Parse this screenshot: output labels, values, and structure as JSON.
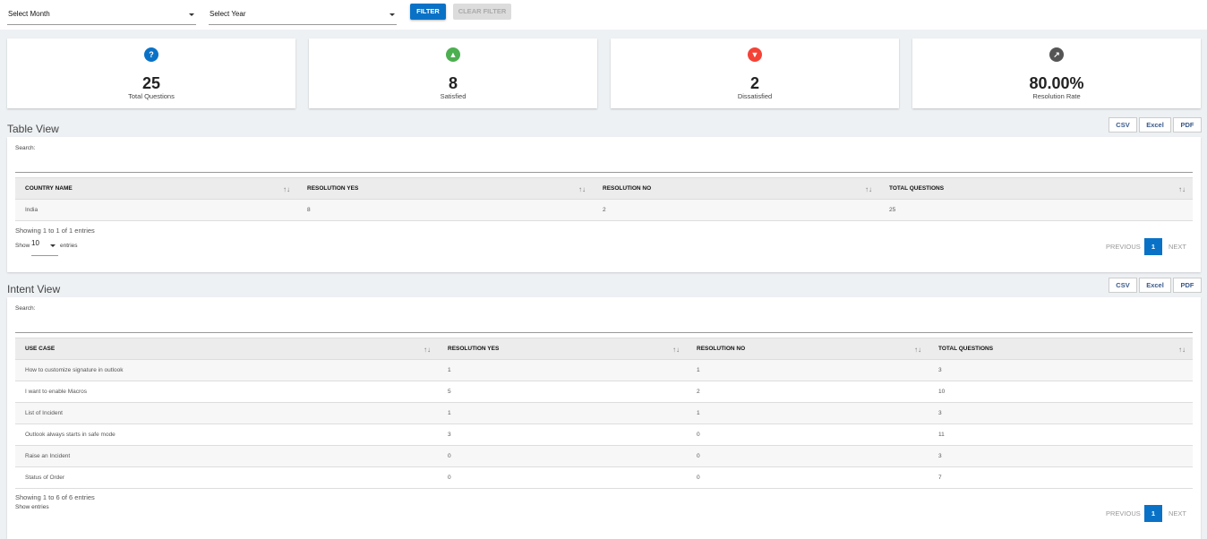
{
  "filters": {
    "month_placeholder": "Select Month",
    "year_placeholder": "Select Year",
    "filter_label": "FILTER",
    "clear_label": "CLEAR FILTER"
  },
  "cards": [
    {
      "value": "25",
      "label": "Total Questions",
      "icon": "question-icon",
      "color": "#0a72c6"
    },
    {
      "value": "8",
      "label": "Satisfied",
      "icon": "thumbs-up-icon",
      "color": "#4caf50"
    },
    {
      "value": "2",
      "label": "Dissatisfied",
      "icon": "thumbs-down-icon",
      "color": "#f44336"
    },
    {
      "value": "80.00%",
      "label": "Resolution Rate",
      "icon": "trending-up-icon",
      "color": "#555555"
    }
  ],
  "export": {
    "csv": "CSV",
    "excel": "Excel",
    "pdf": "PDF"
  },
  "table_view": {
    "title": "Table View",
    "search_label": "Search:",
    "columns": [
      "COUNTRY NAME",
      "RESOLUTION YES",
      "RESOLUTION NO",
      "TOTAL QUESTIONS"
    ],
    "rows": [
      [
        "India",
        "8",
        "2",
        "25"
      ]
    ],
    "info": "Showing 1 to 1 of 1 entries",
    "show": "Show",
    "page_size": "10",
    "entries": "entries",
    "previous": "PREVIOUS",
    "page": "1",
    "next": "NEXT"
  },
  "intent_view": {
    "title": "Intent View",
    "search_label": "Search:",
    "columns": [
      "USE CASE",
      "RESOLUTION YES",
      "RESOLUTION NO",
      "TOTAL QUESTIONS"
    ],
    "rows": [
      [
        "How to customize signature in outlook",
        "1",
        "1",
        "3"
      ],
      [
        "I want to enable Macros",
        "5",
        "2",
        "10"
      ],
      [
        "List of Incident",
        "1",
        "1",
        "3"
      ],
      [
        "Outlook always starts in safe mode",
        "3",
        "0",
        "11"
      ],
      [
        "Raise an Incident",
        "0",
        "0",
        "3"
      ],
      [
        "Status of Order",
        "0",
        "0",
        "7"
      ]
    ],
    "info": "Showing 1 to 6 of 6 entries",
    "show_entries": "Show entries",
    "previous": "PREVIOUS",
    "page": "1",
    "next": "NEXT"
  }
}
